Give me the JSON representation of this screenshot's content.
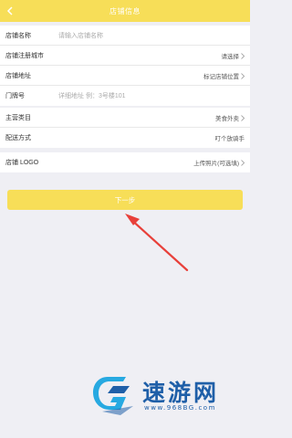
{
  "header": {
    "title": "店铺信息"
  },
  "shop_form": {
    "name": {
      "label": "店铺名称",
      "placeholder": "请输入店铺名称"
    },
    "city": {
      "label": "店铺注册城市",
      "value": "请选择"
    },
    "address": {
      "label": "店铺地址",
      "value": "标记店铺位置"
    },
    "door": {
      "label": "门牌号",
      "placeholder": "详细地址 例：3号楼101"
    }
  },
  "business": {
    "category": {
      "label": "主营类目",
      "value": "美食外卖"
    },
    "delivery": {
      "label": "配送方式",
      "value": "叮个放骑手"
    }
  },
  "logo": {
    "label": "店铺 LOGO",
    "value": "上传照片(可选填)"
  },
  "next_button": {
    "label": "下一步"
  },
  "watermark": {
    "title": "速游网",
    "url": "www.968BG.com"
  },
  "colors": {
    "header": "#f7de58",
    "button": "#f7de58",
    "arrow": "#e8403a",
    "watermark": "#1f5fa8"
  }
}
